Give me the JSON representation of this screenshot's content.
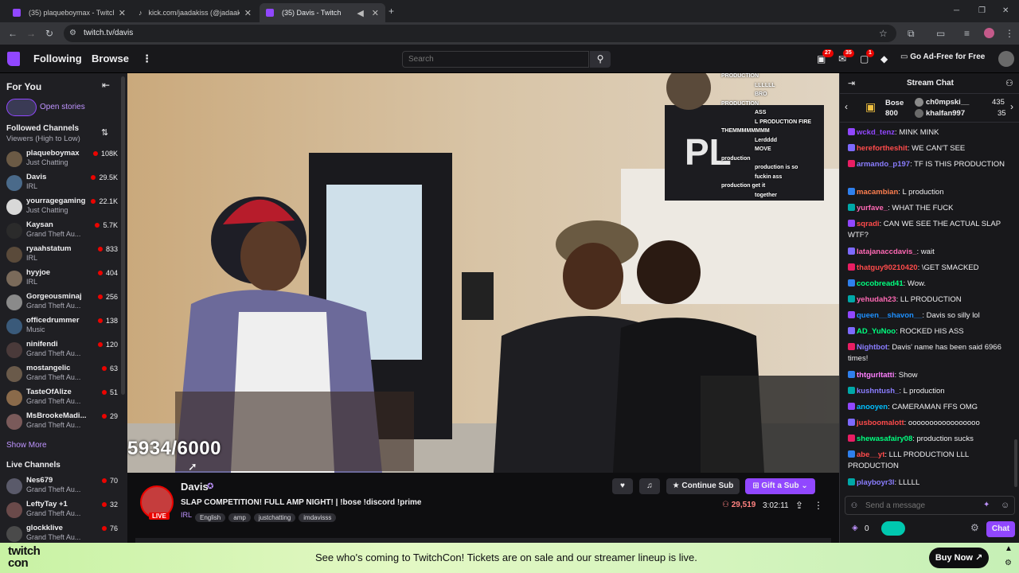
{
  "browser": {
    "tabs": [
      {
        "title": "(35) plaqueboymax - Twitch",
        "active": false
      },
      {
        "title": "kick.com/jaadakiss (@jadaakiss...",
        "active": false
      },
      {
        "title": "(35) Davis - Twitch",
        "active": true
      }
    ],
    "url": "twitch.tv/davis"
  },
  "nav": {
    "following": "Following",
    "browse": "Browse",
    "search_placeholder": "Search",
    "badge_1": "27",
    "badge_2": "35",
    "badge_3": "1",
    "ad_free": "Go Ad-Free for Free"
  },
  "sidebar": {
    "for_you": "For You",
    "open_stories": "Open stories",
    "followed": "Followed Channels",
    "sort": "Viewers (High to Low)",
    "followed_channels": [
      {
        "name": "plaqueboymax",
        "game": "Just Chatting",
        "viewers": "108K",
        "color": "#6b5a45"
      },
      {
        "name": "Davis",
        "game": "IRL",
        "viewers": "29.5K",
        "color": "#4a6a8a"
      },
      {
        "name": "yourragegaming",
        "game": "Just Chatting",
        "viewers": "22.1K",
        "color": "#d8d8d8"
      },
      {
        "name": "Kaysan",
        "game": "Grand Theft Au...",
        "viewers": "5.7K",
        "color": "#2b2b2b"
      },
      {
        "name": "ryaahstatum",
        "game": "IRL",
        "viewers": "833",
        "color": "#5a4a3a"
      },
      {
        "name": "hyyjoe",
        "game": "IRL",
        "viewers": "404",
        "color": "#7a6a5a"
      },
      {
        "name": "Gorgeousminaj",
        "game": "Grand Theft Au...",
        "viewers": "256",
        "color": "#8a8a8a"
      },
      {
        "name": "officedrummer",
        "game": "Music",
        "viewers": "138",
        "color": "#3a5a7a"
      },
      {
        "name": "ninifendi",
        "game": "Grand Theft Au...",
        "viewers": "120",
        "color": "#4a3a3a"
      },
      {
        "name": "mostangelic",
        "game": "Grand Theft Au...",
        "viewers": "63",
        "color": "#6a5a4a"
      },
      {
        "name": "TasteOfAlize",
        "game": "Grand Theft Au...",
        "viewers": "51",
        "color": "#8a6a4a"
      },
      {
        "name": "MsBrookeMadi...",
        "game": "Grand Theft Au...",
        "viewers": "29",
        "color": "#7a5a5a"
      }
    ],
    "show_more": "Show More",
    "live_channels": "Live Channels",
    "live": [
      {
        "name": "Nes679",
        "game": "Grand Theft Au...",
        "viewers": "70",
        "color": "#5a5a6a"
      },
      {
        "name": "LeftyTay +1",
        "game": "Grand Theft Au...",
        "viewers": "32",
        "color": "#6a4a4a"
      },
      {
        "name": "glockklive",
        "game": "Grand Theft Au...",
        "viewers": "76",
        "color": "#4a4a4a"
      }
    ]
  },
  "video": {
    "counter": "5934/6000",
    "overlay_chat": [
      "PRODUCTION",
      "LLLLLL",
      "BRO",
      "PRODUCTION",
      "ASS",
      "L PRODUCTION FIRE",
      "THEMMMMMMMM",
      "Lerdddd",
      "MOVE",
      "production",
      "production is so",
      "fuckin ass",
      "production get it",
      "together"
    ]
  },
  "channel": {
    "name": "Davis",
    "live": "LIVE",
    "title": "SLAP COMPETITION! FULL AMP NIGHT! | !bose !discord !prime",
    "category": "IRL",
    "tags": [
      "English",
      "amp",
      "justchatting",
      "imdavisss"
    ],
    "viewers": "29,519",
    "uptime": "3:02:11",
    "continue_sub": "Continue Sub",
    "gift_sub": "Gift a Sub"
  },
  "chat": {
    "header": "Stream Chat",
    "gifters": [
      {
        "name": "Bose",
        "count": "800"
      },
      {
        "name": "ch0mpski__",
        "count": "435"
      },
      {
        "name": "khalfan997",
        "count": "35"
      }
    ],
    "messages": [
      {
        "user": "wckd_tenz",
        "text": ": MINK MINK",
        "color": "#9147ff"
      },
      {
        "user": "herefortheshit",
        "text": ": WE CAN'T SEE",
        "color": "#ff4b4b"
      },
      {
        "user": "armando_p197",
        "text": ": TF IS THIS PRODUCTION",
        "color": "#8a7dff"
      },
      {
        "user": "macambian",
        "text": ": L production",
        "color": "#ff7f50"
      },
      {
        "user": "yurfave_",
        "text": ": WHAT THE FUCK",
        "color": "#ff69b4"
      },
      {
        "user": "sqradi",
        "text": ": CAN WE SEE THE ACTUAL SLAP WTF?",
        "color": "#ff4b4b"
      },
      {
        "user": "latajanaccdavis_",
        "text": ": wait",
        "color": "#ff69b4"
      },
      {
        "user": "thatguy90210420",
        "text": ": \\GET SMACKED",
        "color": "#ff4b4b"
      },
      {
        "user": "cocobread41",
        "text": ": Wow.",
        "color": "#00ff7f"
      },
      {
        "user": "yehudah23",
        "text": ": LL PRODUCTION",
        "color": "#ff69b4"
      },
      {
        "user": "queen__shavon__",
        "text": ": Davis so silly lol",
        "color": "#1e90ff"
      },
      {
        "user": "AD_YuNoo",
        "text": ": ROCKED HIS ASS",
        "color": "#00ff7f"
      },
      {
        "user": "Nightbot",
        "text": ": Davis' name has been said 6966 times!",
        "color": "#8a7dff"
      },
      {
        "user": "thtgurltatti",
        "text": ": Show",
        "color": "#ff7fff"
      },
      {
        "user": "kushntush_",
        "text": ": L production",
        "color": "#8a7dff"
      },
      {
        "user": "anooyen",
        "text": ": CAMERAMAN FFS OMG",
        "color": "#00bfff"
      },
      {
        "user": "jusboomalott",
        "text": ": ooooooooooooooooo",
        "color": "#ff4b4b"
      },
      {
        "user": "shewasafairy08",
        "text": ": production sucks",
        "color": "#00ff7f"
      },
      {
        "user": "abe__yt",
        "text": ": LLL PRODUCTION LLL PRODUCTION",
        "color": "#ff4b4b"
      },
      {
        "user": "playboyr3l",
        "text": ": LLLLL",
        "color": "#8a7dff"
      }
    ],
    "input_placeholder": "Send a message",
    "points": "0",
    "chat_button": "Chat"
  },
  "banner": {
    "logo_line1": "twitch",
    "logo_line2": "con",
    "text": "See who's coming to TwitchCon! Tickets are on sale and our streamer lineup is live.",
    "buy": "Buy Now ↗"
  }
}
